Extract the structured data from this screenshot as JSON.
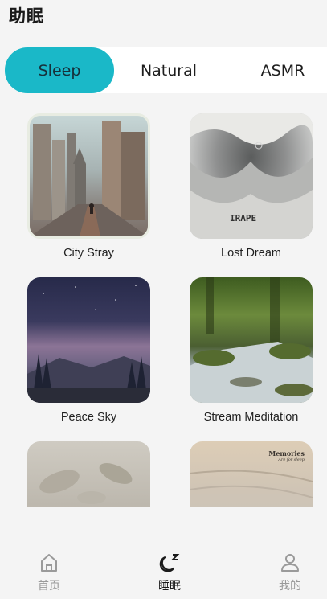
{
  "header": {
    "title": "助眠"
  },
  "tabs": [
    {
      "label": "Sleep",
      "active": true
    },
    {
      "label": "Natural",
      "active": false
    },
    {
      "label": "ASMR",
      "active": false
    }
  ],
  "cards": [
    {
      "label": "City Stray"
    },
    {
      "label": "Lost Dream",
      "thumb_text": "IRAPE"
    },
    {
      "label": "Peace Sky"
    },
    {
      "label": "Stream Meditation"
    },
    {
      "label": ""
    },
    {
      "label": "",
      "thumb_title": "Memories",
      "thumb_subtitle": "Are for sleep"
    }
  ],
  "bottom_nav": [
    {
      "label": "首页",
      "icon": "home-icon",
      "active": false
    },
    {
      "label": "睡眠",
      "icon": "moon-icon",
      "active": true
    },
    {
      "label": "我的",
      "icon": "user-icon",
      "active": false
    }
  ],
  "colors": {
    "accent": "#1ab8c8",
    "background": "#f4f4f4",
    "inactive": "#9a9a9a"
  }
}
